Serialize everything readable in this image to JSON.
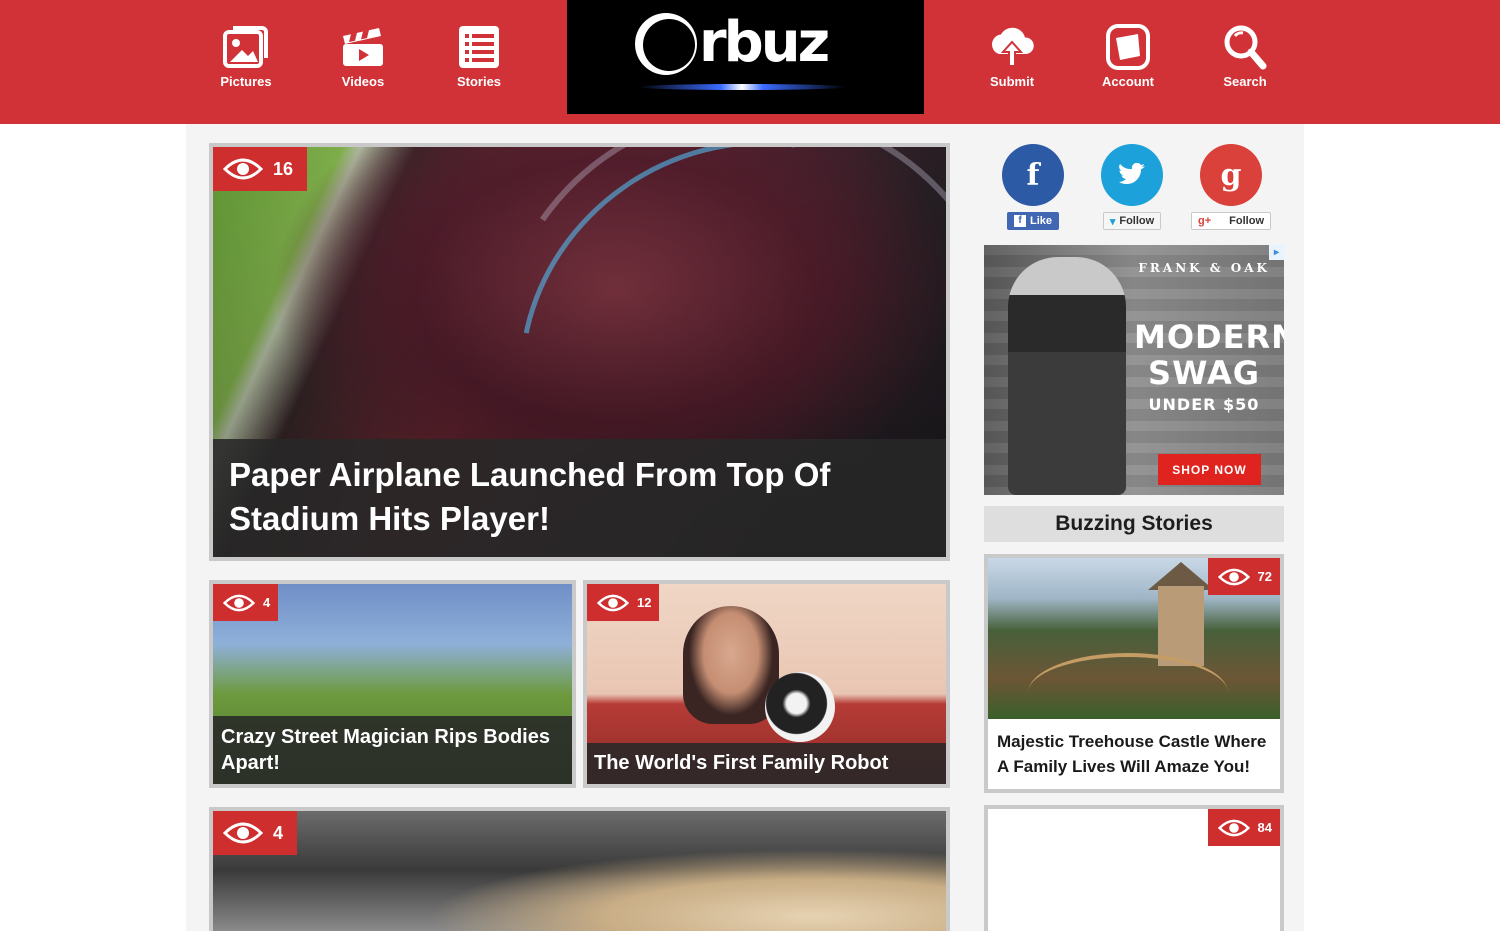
{
  "brand": {
    "logo_text": "rbuz",
    "header_color": "#d13237"
  },
  "nav": {
    "left": [
      {
        "label": "Pictures",
        "icon": "pictures-icon"
      },
      {
        "label": "Videos",
        "icon": "clapperboard-icon"
      },
      {
        "label": "Stories",
        "icon": "list-icon"
      }
    ],
    "right": [
      {
        "label": "Submit",
        "icon": "cloud-upload-icon"
      },
      {
        "label": "Account",
        "icon": "tablet-icon"
      },
      {
        "label": "Search",
        "icon": "search-icon"
      }
    ]
  },
  "hero": {
    "views": "16",
    "title": "Paper Airplane Launched From Top Of Stadium Hits Player!"
  },
  "cards": [
    {
      "views": "4",
      "title": "Crazy Street Magician Rips Bodies Apart!"
    },
    {
      "views": "12",
      "title": "The World's First Family Robot"
    },
    {
      "views": "4",
      "title": ""
    }
  ],
  "social": {
    "facebook": {
      "letter": "f",
      "button": "Like",
      "color": "#2d5aa5"
    },
    "twitter": {
      "letter": "🐦",
      "button": "Follow",
      "color": "#1da1db"
    },
    "google": {
      "letter": "g",
      "button": "Follow",
      "color": "#d9413a"
    }
  },
  "ad": {
    "brand": "FRANK & OAK",
    "headline": "MODERN SWAG",
    "subline": "UNDER $50",
    "cta": "SHOP NOW"
  },
  "sidebar": {
    "heading": "Buzzing Stories",
    "stories": [
      {
        "views": "72",
        "title": "Majestic Treehouse Castle Where A Family Lives Will Amaze You!"
      },
      {
        "views": "84",
        "title": ""
      }
    ]
  }
}
